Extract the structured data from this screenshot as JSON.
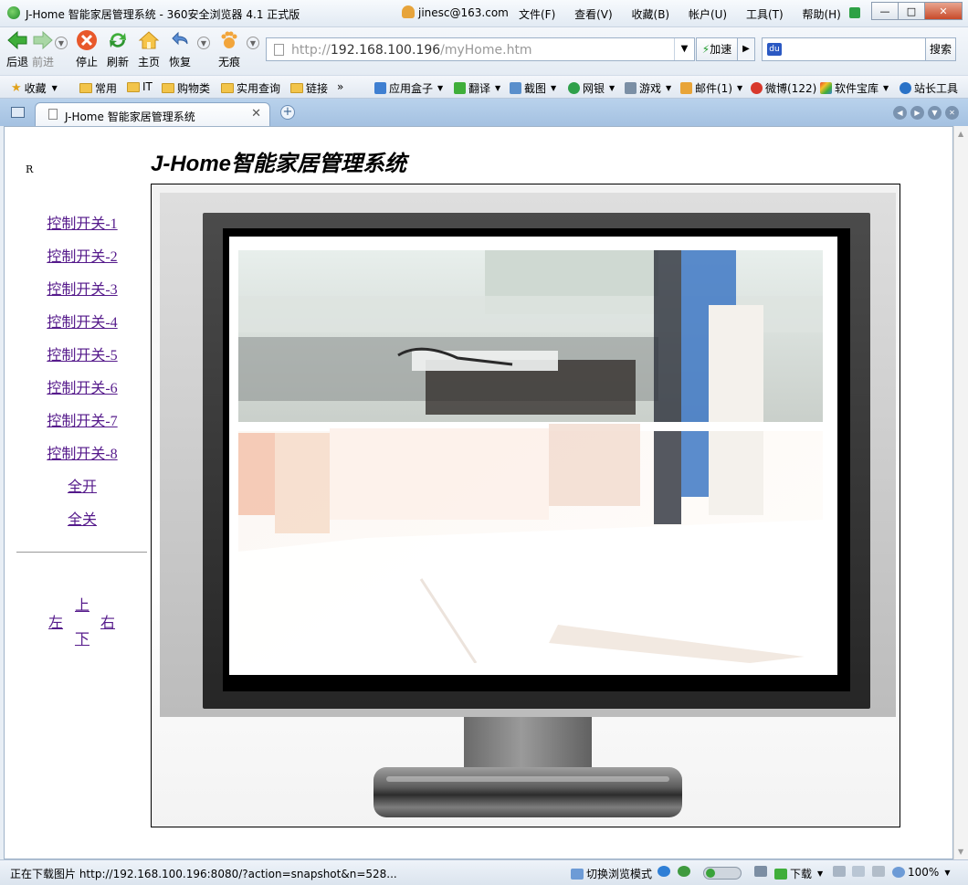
{
  "window": {
    "title": "J-Home 智能家居管理系统 - 360安全浏览器 4.1 正式版",
    "user": "jinesc@163.com",
    "menus": [
      "文件(F)",
      "查看(V)",
      "收藏(B)",
      "帐户(U)",
      "工具(T)",
      "帮助(H)"
    ],
    "controls": {
      "minimize": "—",
      "maximize": "□",
      "close": "✕"
    }
  },
  "toolbar": {
    "back": "后退",
    "forward": "前进",
    "stop": "停止",
    "refresh": "刷新",
    "home": "主页",
    "restore": "恢复",
    "incognito": "无痕",
    "address_prefix": "http://",
    "address_host": "192.168.100.196",
    "address_path": "/myHome.htm",
    "speed": "加速",
    "search_button": "搜索"
  },
  "favorites": {
    "collect": "收藏",
    "items": [
      "常用",
      "IT",
      "购物类",
      "实用查询",
      "链接"
    ],
    "more": "»",
    "apps": [
      "应用盒子",
      "翻译",
      "截图",
      "网银",
      "游戏",
      "邮件(1)",
      "微博(122)",
      "软件宝库",
      "站长工具"
    ]
  },
  "tabs": [
    {
      "label": "J-Home 智能家居管理系统",
      "active": true
    }
  ],
  "page": {
    "marker": "R",
    "title": "J-Home智能家居管理系统",
    "links": [
      "控制开关-1",
      "控制开关-2",
      "控制开关-3",
      "控制开关-4",
      "控制开关-5",
      "控制开关-6",
      "控制开关-7",
      "控制开关-8",
      "全开",
      "全关"
    ],
    "dpad": {
      "up": "上",
      "down": "下",
      "left": "左",
      "right": "右"
    }
  },
  "status": {
    "message": "正在下载图片 http://192.168.100.196:8080/?action=snapshot&n=528...",
    "switch_mode": "切换浏览模式",
    "download": "下载",
    "zoom": "100%"
  },
  "colors": {
    "link_visited": "#551a8b",
    "window_chrome": "#a4c1e1",
    "monitor_bezel": "#262626"
  }
}
